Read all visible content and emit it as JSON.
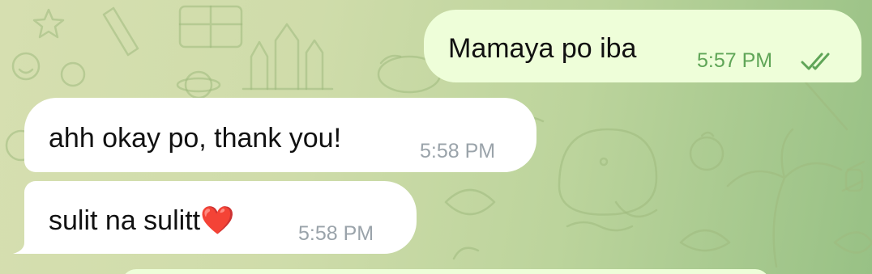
{
  "conversation": {
    "messages": [
      {
        "direction": "outgoing",
        "text": "Mamaya po iba",
        "time": "5:57 PM",
        "status_icon": "double-check-icon"
      },
      {
        "direction": "incoming",
        "text": "ahh okay po, thank you!",
        "time": "5:58 PM"
      },
      {
        "direction": "incoming",
        "text": "sulit na sulitt❤️",
        "time": "5:58 PM"
      }
    ]
  },
  "colors": {
    "outgoing_bubble": "#eefed9",
    "incoming_bubble": "#ffffff",
    "outgoing_time": "#5fa557",
    "incoming_time": "#9aa3aa",
    "background_start": "#d6dfb0",
    "background_end": "#98c185"
  }
}
